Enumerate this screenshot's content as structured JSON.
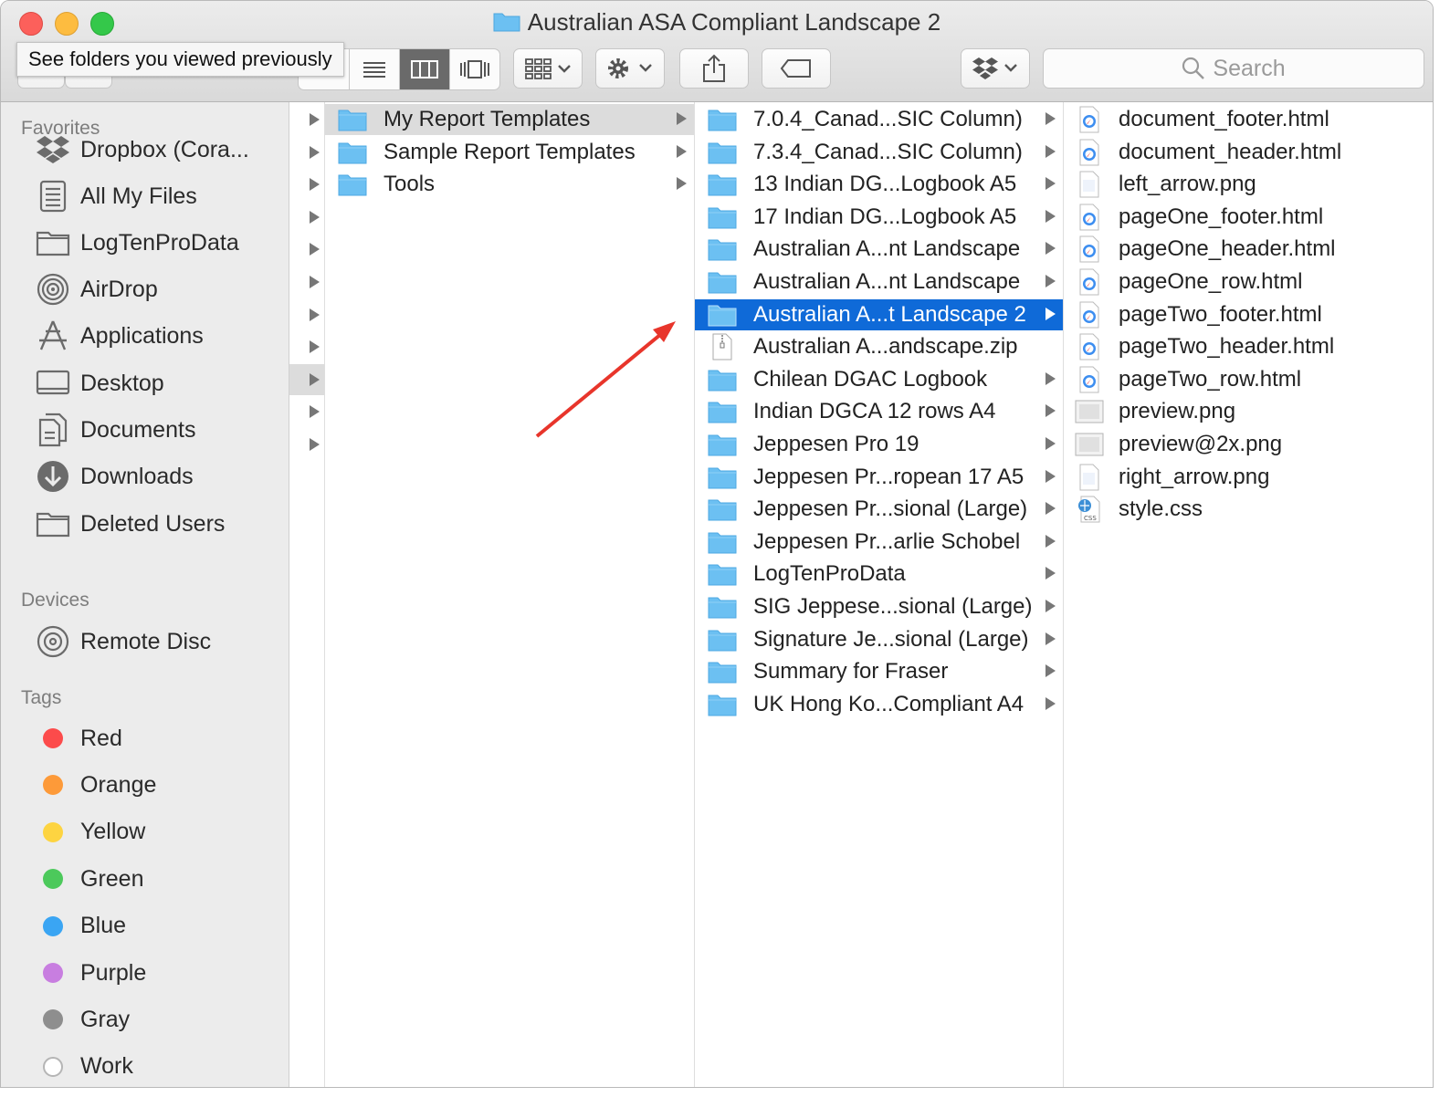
{
  "window": {
    "title": "Australian ASA Compliant Landscape 2"
  },
  "tooltip": "See folders you viewed previously",
  "search": {
    "placeholder": "Search"
  },
  "sidebar": {
    "favorites_title": "Favorites",
    "favorites": [
      {
        "label": "Dropbox (Cora...",
        "icon": "dropbox-icon"
      },
      {
        "label": "All My Files",
        "icon": "all-files-icon"
      },
      {
        "label": "LogTenProData",
        "icon": "folder-icon"
      },
      {
        "label": "AirDrop",
        "icon": "airdrop-icon"
      },
      {
        "label": "Applications",
        "icon": "applications-icon"
      },
      {
        "label": "Desktop",
        "icon": "desktop-icon"
      },
      {
        "label": "Documents",
        "icon": "documents-icon"
      },
      {
        "label": "Downloads",
        "icon": "downloads-icon"
      },
      {
        "label": "Deleted Users",
        "icon": "folder-icon"
      }
    ],
    "devices_title": "Devices",
    "devices": [
      {
        "label": "Remote Disc",
        "icon": "disc-icon"
      }
    ],
    "tags_title": "Tags",
    "tags": [
      {
        "label": "Red",
        "color": "#fc4b4b"
      },
      {
        "label": "Orange",
        "color": "#fd9a39"
      },
      {
        "label": "Yellow",
        "color": "#fdd441"
      },
      {
        "label": "Green",
        "color": "#4cc95b"
      },
      {
        "label": "Blue",
        "color": "#3aa5f3"
      },
      {
        "label": "Purple",
        "color": "#c87ee0"
      },
      {
        "label": "Gray",
        "color": "#8e8e8e"
      },
      {
        "label": "Work",
        "color": "#ffffff"
      }
    ]
  },
  "column1": [
    {
      "name": "My Report Templates",
      "type": "folder",
      "selected": "gray"
    },
    {
      "name": "Sample Report Templates",
      "type": "folder"
    },
    {
      "name": "Tools",
      "type": "folder"
    }
  ],
  "column2": [
    {
      "name": "7.0.4_Canad...SIC Column)",
      "type": "folder"
    },
    {
      "name": "7.3.4_Canad...SIC Column)",
      "type": "folder"
    },
    {
      "name": "13 Indian DG...Logbook A5",
      "type": "folder"
    },
    {
      "name": "17 Indian DG...Logbook A5",
      "type": "folder"
    },
    {
      "name": "Australian A...nt Landscape",
      "type": "folder"
    },
    {
      "name": "Australian A...nt Landscape",
      "type": "folder"
    },
    {
      "name": "Australian A...t Landscape 2",
      "type": "folder",
      "selected": "blue"
    },
    {
      "name": "Australian A...andscape.zip",
      "type": "zip"
    },
    {
      "name": "Chilean DGAC Logbook",
      "type": "folder"
    },
    {
      "name": "Indian DGCA 12 rows A4",
      "type": "folder"
    },
    {
      "name": "Jeppesen Pro 19",
      "type": "folder"
    },
    {
      "name": "Jeppesen Pr...ropean 17 A5",
      "type": "folder"
    },
    {
      "name": "Jeppesen Pr...sional (Large)",
      "type": "folder"
    },
    {
      "name": "Jeppesen Pr...arlie Schobel",
      "type": "folder"
    },
    {
      "name": "LogTenProData",
      "type": "folder"
    },
    {
      "name": "SIG Jeppese...sional (Large)",
      "type": "folder"
    },
    {
      "name": "Signature Je...sional (Large)",
      "type": "folder"
    },
    {
      "name": "Summary for Fraser",
      "type": "folder"
    },
    {
      "name": "UK Hong Ko...Compliant A4",
      "type": "folder"
    }
  ],
  "column3": [
    {
      "name": "document_footer.html",
      "type": "html"
    },
    {
      "name": "document_header.html",
      "type": "html"
    },
    {
      "name": "left_arrow.png",
      "type": "png"
    },
    {
      "name": "pageOne_footer.html",
      "type": "html"
    },
    {
      "name": "pageOne_header.html",
      "type": "html"
    },
    {
      "name": "pageOne_row.html",
      "type": "html"
    },
    {
      "name": "pageTwo_footer.html",
      "type": "html"
    },
    {
      "name": "pageTwo_header.html",
      "type": "html"
    },
    {
      "name": "pageTwo_row.html",
      "type": "html"
    },
    {
      "name": "preview.png",
      "type": "image"
    },
    {
      "name": "preview@2x.png",
      "type": "image"
    },
    {
      "name": "right_arrow.png",
      "type": "png"
    },
    {
      "name": "style.css",
      "type": "css"
    }
  ],
  "colors": {
    "selection_blue": "#0f6ad8",
    "folder_blue": "#6cc0f2",
    "arrow_red": "#e8352b"
  }
}
